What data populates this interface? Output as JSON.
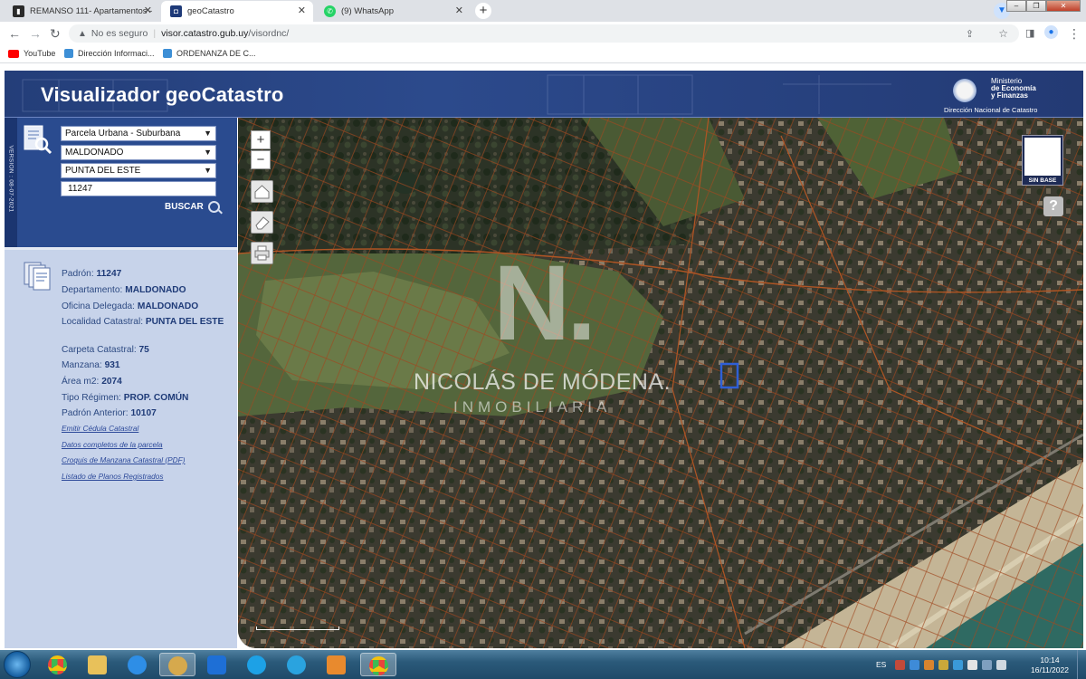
{
  "browser": {
    "tabs": [
      {
        "title": "REMANSO 111- Apartamentos -",
        "icon": "building-favicon",
        "color": "#2a2a2a",
        "active": false
      },
      {
        "title": "geoCatastro",
        "icon": "geocatastro-favicon",
        "color": "#1e3a78",
        "active": true
      },
      {
        "title": "(9) WhatsApp",
        "icon": "whatsapp-favicon",
        "color": "#25d366",
        "active": false
      }
    ],
    "address": {
      "security": "No es seguro",
      "host": "visor.catastro.gub.uy",
      "path": "/visordnc/"
    },
    "bookmarks": [
      {
        "label": "YouTube",
        "icon": "youtube-icon",
        "color": "#ff0000"
      },
      {
        "label": "Dirección Informaci...",
        "icon": "dgi-icon",
        "color": "#3d8fd6"
      },
      {
        "label": "ORDENANZA DE C...",
        "icon": "dgi-icon",
        "color": "#3d8fd6"
      }
    ]
  },
  "app": {
    "title": "Visualizador geoCatastro",
    "logo": {
      "line1": "Ministerio",
      "line2": "de Economía",
      "line3": "y Finanzas",
      "line4": "Dirección Nacional de Catastro"
    },
    "version": "VERSION : 08-07-2021"
  },
  "search": {
    "type": "Parcela Urbana - Suburbana",
    "department": "MALDONADO",
    "locality": "PUNTA DEL ESTE",
    "padron_value": "11247",
    "button": "BUSCAR"
  },
  "info": {
    "fields": [
      {
        "label": "Padrón:",
        "value": "11247"
      },
      {
        "label": "Departamento:",
        "value": "MALDONADO"
      },
      {
        "label": "Oficina Delegada:",
        "value": "MALDONADO"
      },
      {
        "label": "Localidad Catastral:",
        "value": "PUNTA DEL ESTE"
      },
      {
        "label": "Carpeta Catastral:",
        "value": "75"
      },
      {
        "label": "Manzana:",
        "value": "931"
      },
      {
        "label": "Área m2:",
        "value": "2074"
      },
      {
        "label": "Tipo Régimen:",
        "value": "PROP. COMÚN"
      },
      {
        "label": "Padrón Anterior:",
        "value": "10107"
      }
    ],
    "links": [
      "Emitir Cédula Catastral",
      "Datos completos de la parcela",
      "Croquis de Manzana Catastral (PDF)",
      "Listado de Planos Registrados"
    ]
  },
  "map": {
    "zoom_in": "+",
    "zoom_out": "−",
    "base_layer_label": "SIN BASE",
    "help": "?",
    "watermark": {
      "letter": "N.",
      "name": "NICOLÁS DE MÓDENA.",
      "sub": "INMOBILIARIA"
    }
  },
  "taskbar": {
    "apps": [
      {
        "name": "chrome",
        "color": "#e8453c"
      },
      {
        "name": "explorer",
        "color": "#e8c15a"
      },
      {
        "name": "internet-explorer",
        "color": "#2e8ee6"
      },
      {
        "name": "paint",
        "color": "#d6a94d",
        "active": true
      },
      {
        "name": "teamviewer",
        "color": "#1e6fd6"
      },
      {
        "name": "skype",
        "color": "#1da1e6"
      },
      {
        "name": "telegram",
        "color": "#2aa3df"
      },
      {
        "name": "media-player",
        "color": "#e88a2e"
      },
      {
        "name": "chrome-active",
        "color": "#e8453c",
        "active": true
      }
    ],
    "lang": "ES",
    "time": "10:14",
    "date": "16/11/2022"
  }
}
